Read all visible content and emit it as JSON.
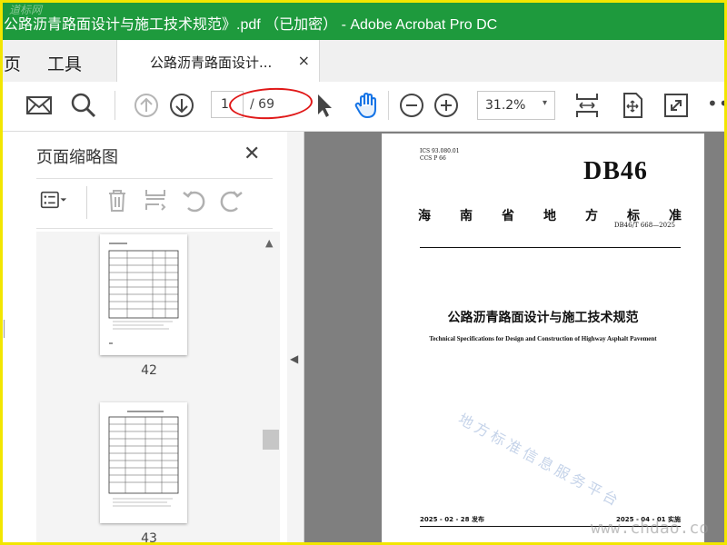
{
  "window": {
    "title": "公路沥青路面设计与施工技术规范》.pdf （已加密） - Adobe Acrobat Pro DC",
    "watermark": "道标网"
  },
  "nav": {
    "page_label": "页",
    "tools_label": "工具"
  },
  "tab": {
    "label": "公路沥青路面设计...",
    "close": "×"
  },
  "toolbar": {
    "current_page": "1",
    "page_total": "/ 69",
    "zoom": "31.2%",
    "zoom_arrow": "▾",
    "more": "•••",
    "icons": [
      "mail-icon",
      "search-icon",
      "page-up-icon",
      "page-down-icon",
      "select-cursor-icon",
      "hand-tool-icon",
      "zoom-out-icon",
      "zoom-in-icon",
      "fit-page-icon",
      "rotate-view-icon",
      "fullscreen-icon"
    ]
  },
  "left_panel": {
    "title": "页面缩略图",
    "close": "✕",
    "icons": [
      "thumbnail-options-icon",
      "delete-page-icon",
      "extract-page-icon",
      "rotate-left-icon",
      "rotate-right-icon"
    ],
    "thumbnails": [
      {
        "label": "42"
      },
      {
        "label": "43"
      }
    ]
  },
  "document": {
    "ics_line1": "ICS  93.080.01",
    "ics_line2": "CCS  P 66",
    "db_code": "DB46",
    "province": [
      "海",
      "南",
      "省",
      "地",
      "方",
      "标",
      "准"
    ],
    "std_number": "DB46/T 668—2025",
    "title": "公路沥青路面设计与施工技术规范",
    "title_en": "Technical Specifications for Design and Construction of Highway Asphalt Pavement",
    "release": "2025 - 02 - 28 发布",
    "implement": "2025 - 04 - 01 实施",
    "watermark": "地方标准信息服务平台",
    "site_watermark": "www.chdao.co"
  },
  "colors": {
    "titlebar": "#1e9a3d",
    "annotation": "#e01818",
    "frame": "#f2e600"
  }
}
